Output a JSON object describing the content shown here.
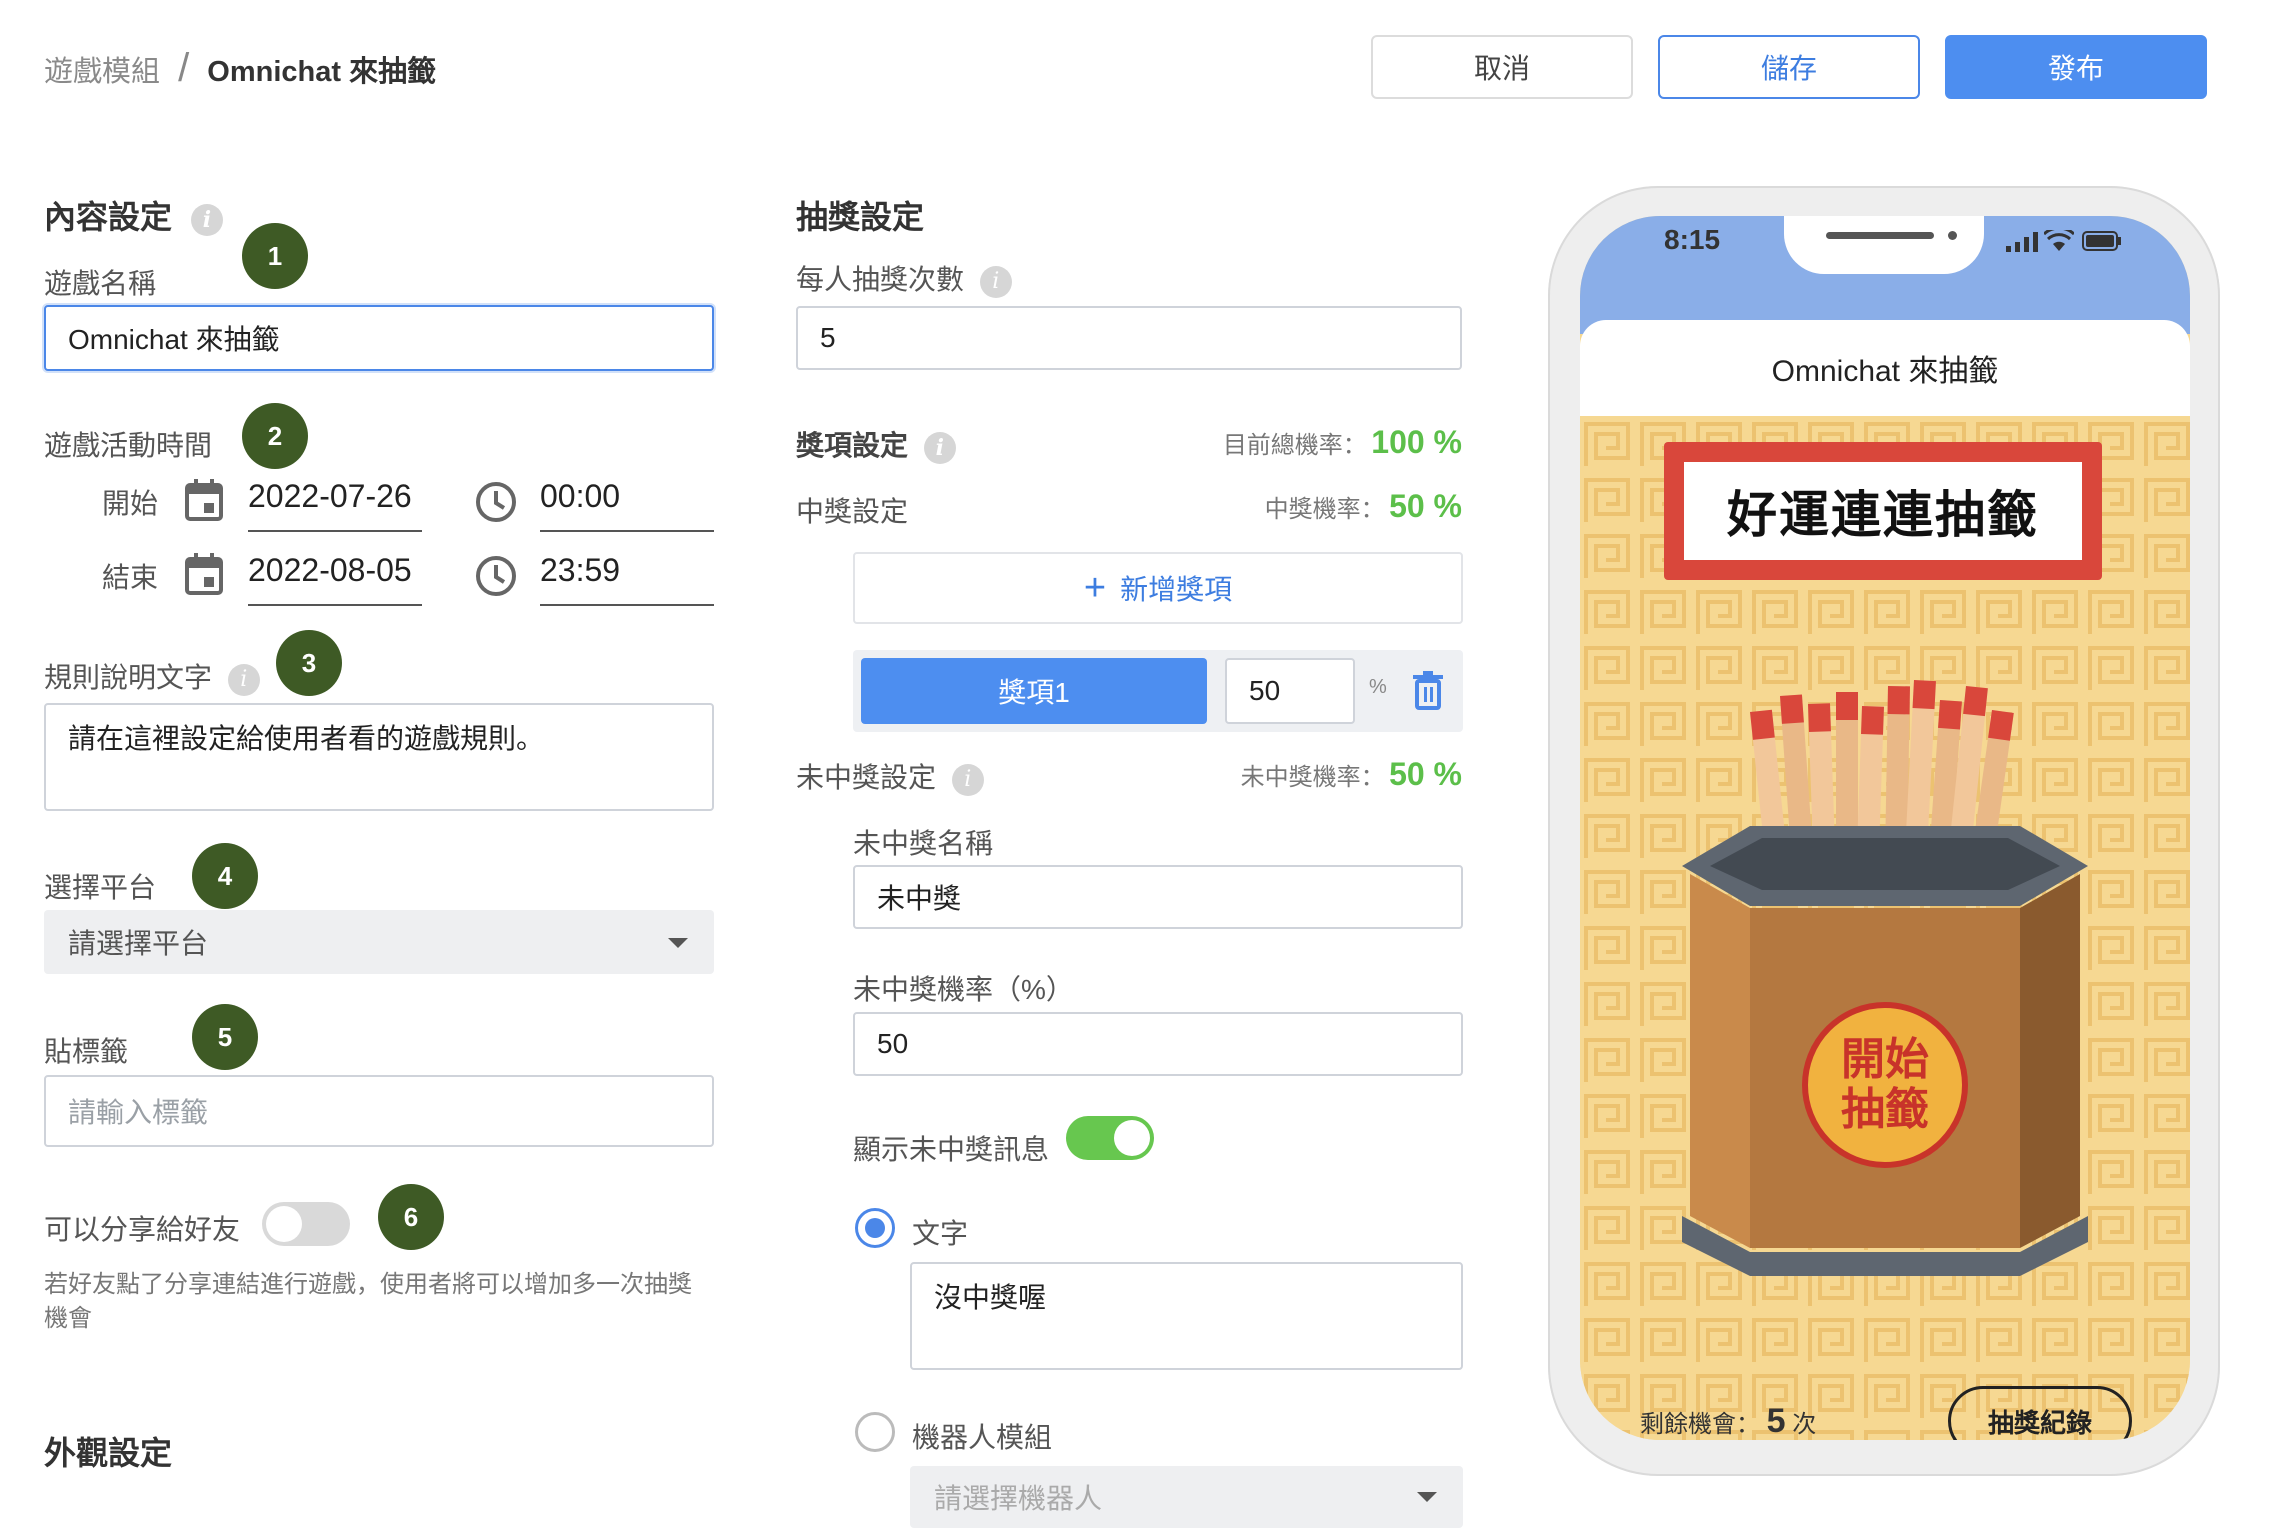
{
  "breadcrumb": {
    "parent": "遊戲模組",
    "separator": "/",
    "current": "Omnichat 來抽籤"
  },
  "actions": {
    "cancel": "取消",
    "save": "儲存",
    "publish": "發布"
  },
  "content_settings": {
    "title": "內容設定",
    "game_name": {
      "label": "遊戲名稱",
      "value": "Omnichat 來抽籤",
      "step": "1"
    },
    "schedule": {
      "label": "遊戲活動時間",
      "step": "2",
      "start_label": "開始",
      "start_date": "2022-07-26",
      "start_time": "00:00",
      "end_label": "結束",
      "end_date": "2022-08-05",
      "end_time": "23:59"
    },
    "rules": {
      "label": "規則說明文字",
      "step": "3",
      "value": "請在這裡設定給使用者看的遊戲規則。"
    },
    "platform": {
      "label": "選擇平台",
      "step": "4",
      "placeholder": "請選擇平台"
    },
    "tags": {
      "label": "貼標籤",
      "step": "5",
      "placeholder": "請輸入標籤"
    },
    "share": {
      "label": "可以分享給好友",
      "step": "6",
      "enabled": false,
      "help": "若好友點了分享連結進行遊戲，使用者將可以增加多一次抽獎",
      "help2": "機會"
    },
    "appearance_title": "外觀設定"
  },
  "lottery_settings": {
    "title": "抽獎設定",
    "draws_per_user": {
      "label": "每人抽獎次數",
      "value": "5"
    },
    "prize_settings": {
      "label": "獎項設定",
      "total_rate_label": "目前總機率：",
      "total_rate": "100 %"
    },
    "win_settings": {
      "label": "中獎設定",
      "rate_label": "中獎機率：",
      "rate": "50 %"
    },
    "add_prize": "新增獎項",
    "prizes": [
      {
        "name": "獎項1",
        "percent": "50",
        "unit": "%"
      }
    ],
    "lose_settings": {
      "label": "未中獎設定",
      "rate_label": "未中獎機率：",
      "rate": "50 %",
      "name_label": "未中獎名稱",
      "name_value": "未中獎",
      "rate_field_label": "未中獎機率（%）",
      "rate_field_value": "50",
      "show_message_label": "顯示未中獎訊息",
      "show_message": true,
      "text_option": "文字",
      "text_value": "沒中獎喔",
      "bot_option": "機器人模組",
      "bot_placeholder": "請選擇機器人",
      "selected_option": "文字"
    }
  },
  "phone_preview": {
    "time": "8:15",
    "header_title": "Omnichat 來抽籤",
    "banner": "好運連連抽籤",
    "start_button_line1": "開始",
    "start_button_line2": "抽籤",
    "remaining_label": "剩餘機會：",
    "remaining_count": "5",
    "remaining_unit": "次",
    "history_button": "抽獎紀錄"
  },
  "colors": {
    "primary": "#4d8ef0",
    "step_badge": "#3e5a25",
    "success": "#5cbf4a",
    "phone_header": "#8aaee8",
    "game_bg": "#f6d892",
    "banner_red": "#d9473b"
  },
  "icons": [
    "info-icon",
    "calendar-icon",
    "clock-icon",
    "plus-icon",
    "trash-icon",
    "chevron-down-icon",
    "signal-icon",
    "wifi-icon",
    "battery-icon"
  ]
}
